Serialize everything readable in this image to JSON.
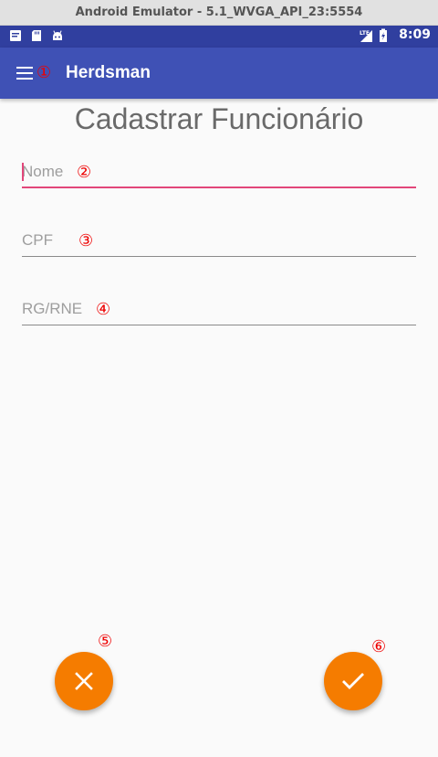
{
  "window": {
    "title": "Android Emulator - 5.1_WVGA_API_23:5554"
  },
  "status_bar": {
    "time": "8:09",
    "network": "LTE"
  },
  "app_bar": {
    "title": "Herdsman"
  },
  "page": {
    "title": "Cadastrar Funcionário"
  },
  "form": {
    "name": {
      "placeholder": "Nome",
      "value": ""
    },
    "cpf": {
      "placeholder": "CPF",
      "value": ""
    },
    "rg": {
      "placeholder": "RG/RNE",
      "value": ""
    }
  },
  "markers": [
    "①",
    "②",
    "③",
    "④",
    "⑤",
    "⑥"
  ],
  "colors": {
    "primary": "#3f51b5",
    "primary_dark": "#303f9f",
    "accent": "#e2467a",
    "fab": "#f57c00"
  },
  "icons": {
    "menu": "hamburger-menu",
    "cancel": "close",
    "confirm": "check"
  }
}
